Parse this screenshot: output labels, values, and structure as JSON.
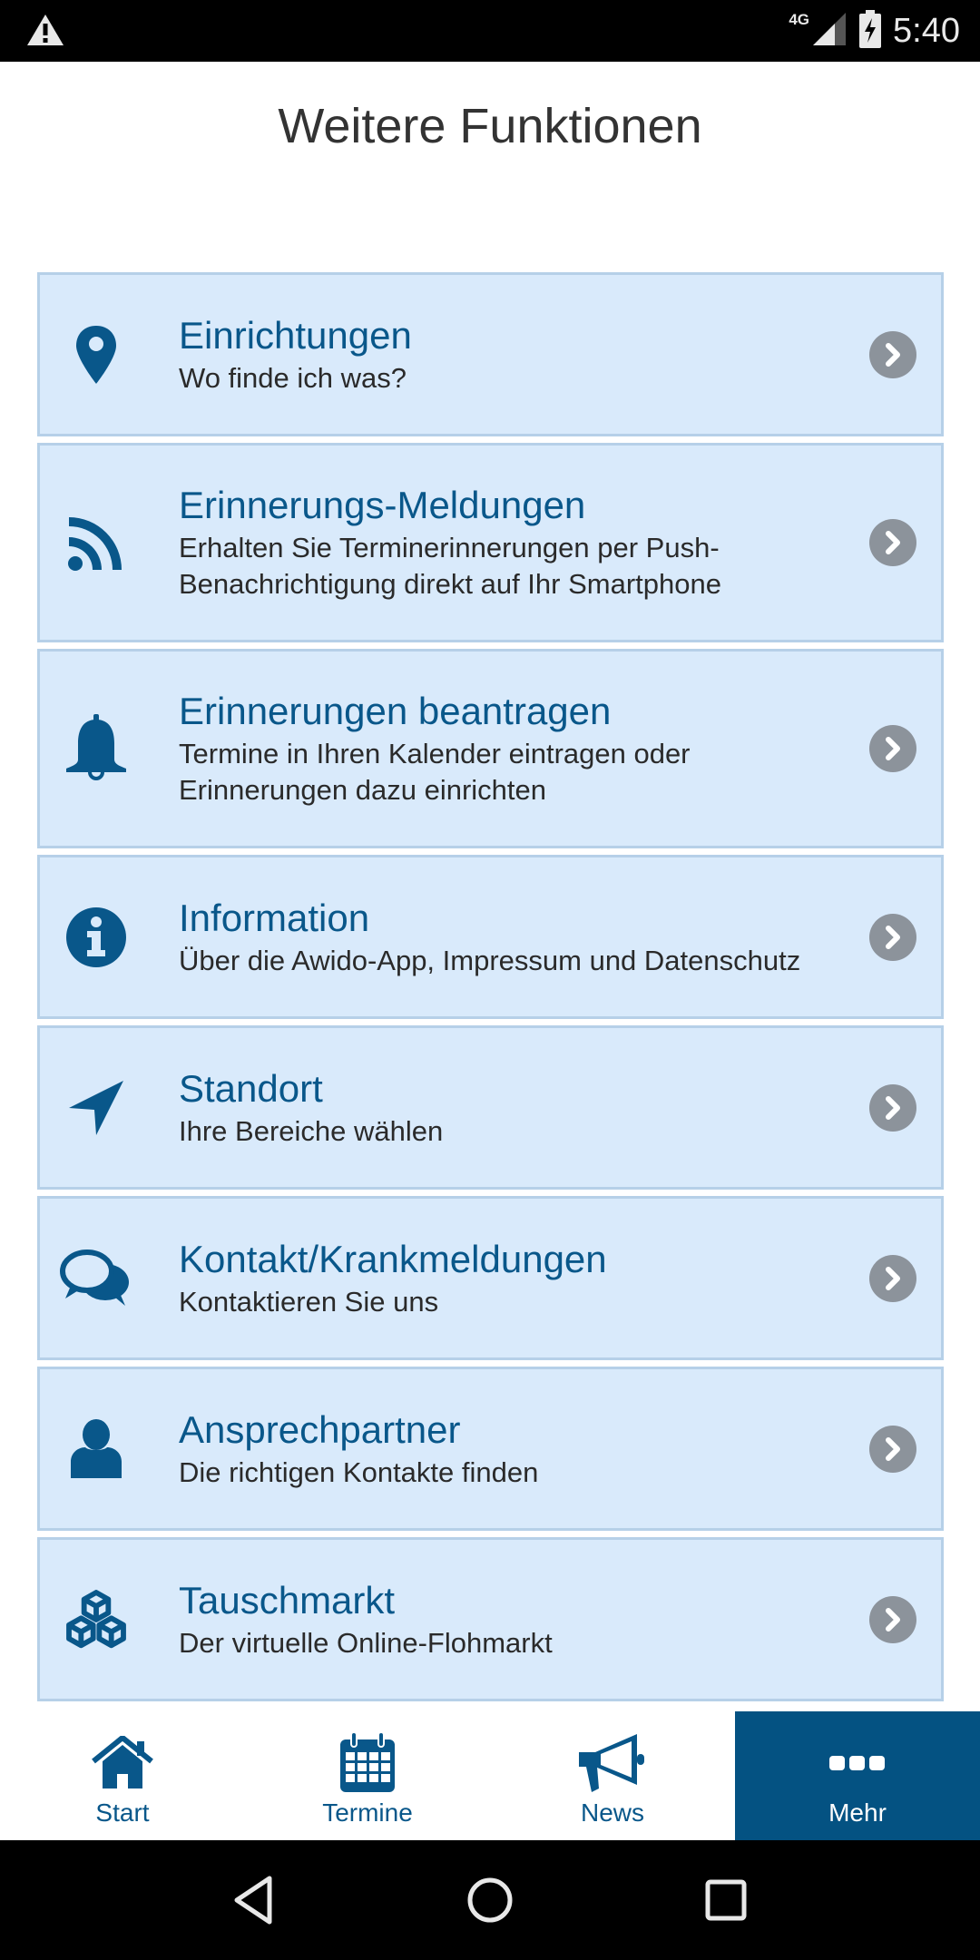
{
  "status_bar": {
    "alert_icon": "warning-icon",
    "network": "4G",
    "time": "5:40"
  },
  "header": {
    "title": "Weitere Funktionen"
  },
  "colors": {
    "accent": "#09578a",
    "active_tab_bg": "#045282",
    "card_bg": "#d9eafb",
    "card_border": "#b6d0e8",
    "chevron_bg": "#8c939b"
  },
  "menu": [
    {
      "icon": "map-marker-icon",
      "title": "Einrichtungen",
      "subtitle": "Wo finde ich was?"
    },
    {
      "icon": "rss-icon",
      "title": "Erinnerungs-Meldungen",
      "subtitle": "Erhalten Sie Terminerinnerungen per Push-Benachrichtigung direkt auf Ihr Smartphone"
    },
    {
      "icon": "bell-icon",
      "title": "Erinnerungen beantragen",
      "subtitle": "Termine in Ihren Kalender eintragen oder Erinnerungen dazu einrichten"
    },
    {
      "icon": "info-icon",
      "title": "Information",
      "subtitle": "Über die Awido-App, Impressum und Datenschutz"
    },
    {
      "icon": "location-arrow-icon",
      "title": "Standort",
      "subtitle": "Ihre Bereiche wählen"
    },
    {
      "icon": "chat-bubbles-icon",
      "title": "Kontakt/Krankmeldungen",
      "subtitle": "Kontaktieren Sie uns"
    },
    {
      "icon": "user-icon",
      "title": "Ansprechpartner",
      "subtitle": "Die richtigen Kontakte finden"
    },
    {
      "icon": "cubes-icon",
      "title": "Tauschmarkt",
      "subtitle": "Der virtuelle Online-Flohmarkt"
    }
  ],
  "bottom_nav": {
    "items": [
      {
        "label": "Start",
        "icon": "home-icon",
        "active": false
      },
      {
        "label": "Termine",
        "icon": "calendar-icon",
        "active": false
      },
      {
        "label": "News",
        "icon": "megaphone-icon",
        "active": false
      },
      {
        "label": "Mehr",
        "icon": "more-icon",
        "active": true
      }
    ]
  },
  "system_nav": {
    "back": "back-icon",
    "home": "home-circle-icon",
    "recents": "recents-icon"
  }
}
